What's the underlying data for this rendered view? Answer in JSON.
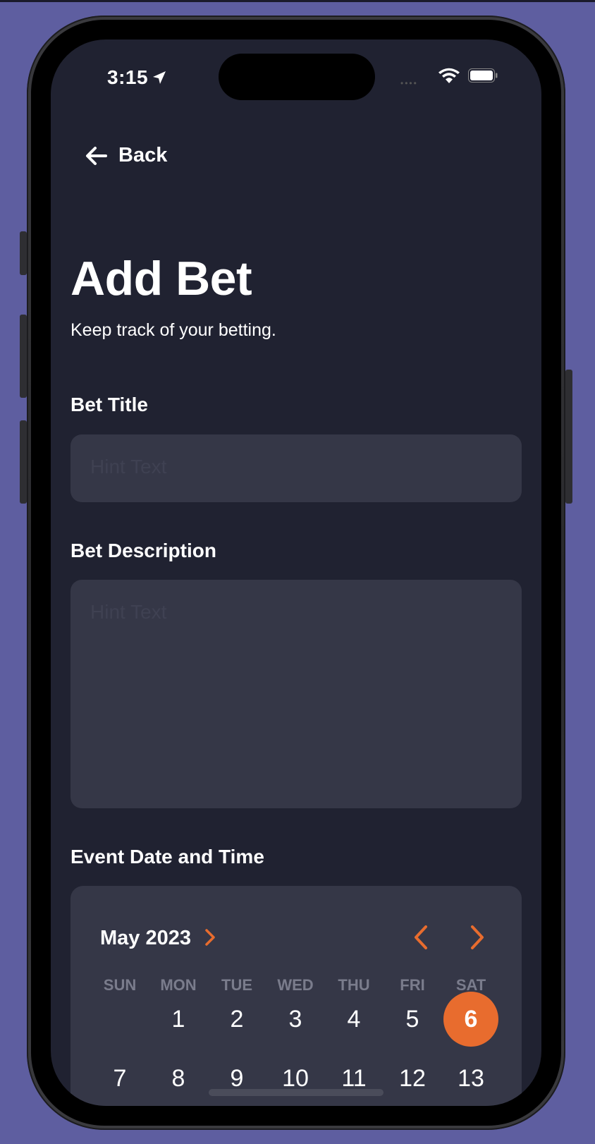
{
  "status_bar": {
    "time": "3:15"
  },
  "nav": {
    "back_label": "Back"
  },
  "header": {
    "title": "Add Bet",
    "subtitle": "Keep track of your betting."
  },
  "form": {
    "title_label": "Bet Title",
    "title_placeholder": "Hint Text",
    "description_label": "Bet Description",
    "description_placeholder": "Hint Text",
    "date_label": "Event Date and Time"
  },
  "calendar": {
    "month": "May 2023",
    "weekdays": [
      "SUN",
      "MON",
      "TUE",
      "WED",
      "THU",
      "FRI",
      "SAT"
    ],
    "week1": [
      "",
      "1",
      "2",
      "3",
      "4",
      "5",
      "6"
    ],
    "week2": [
      "7",
      "8",
      "9",
      "10",
      "11",
      "12",
      "13"
    ],
    "selected_day": "6"
  },
  "colors": {
    "accent": "#e86c2e",
    "background": "#202231",
    "field": "#353747",
    "device_background": "#5e5ea0"
  }
}
